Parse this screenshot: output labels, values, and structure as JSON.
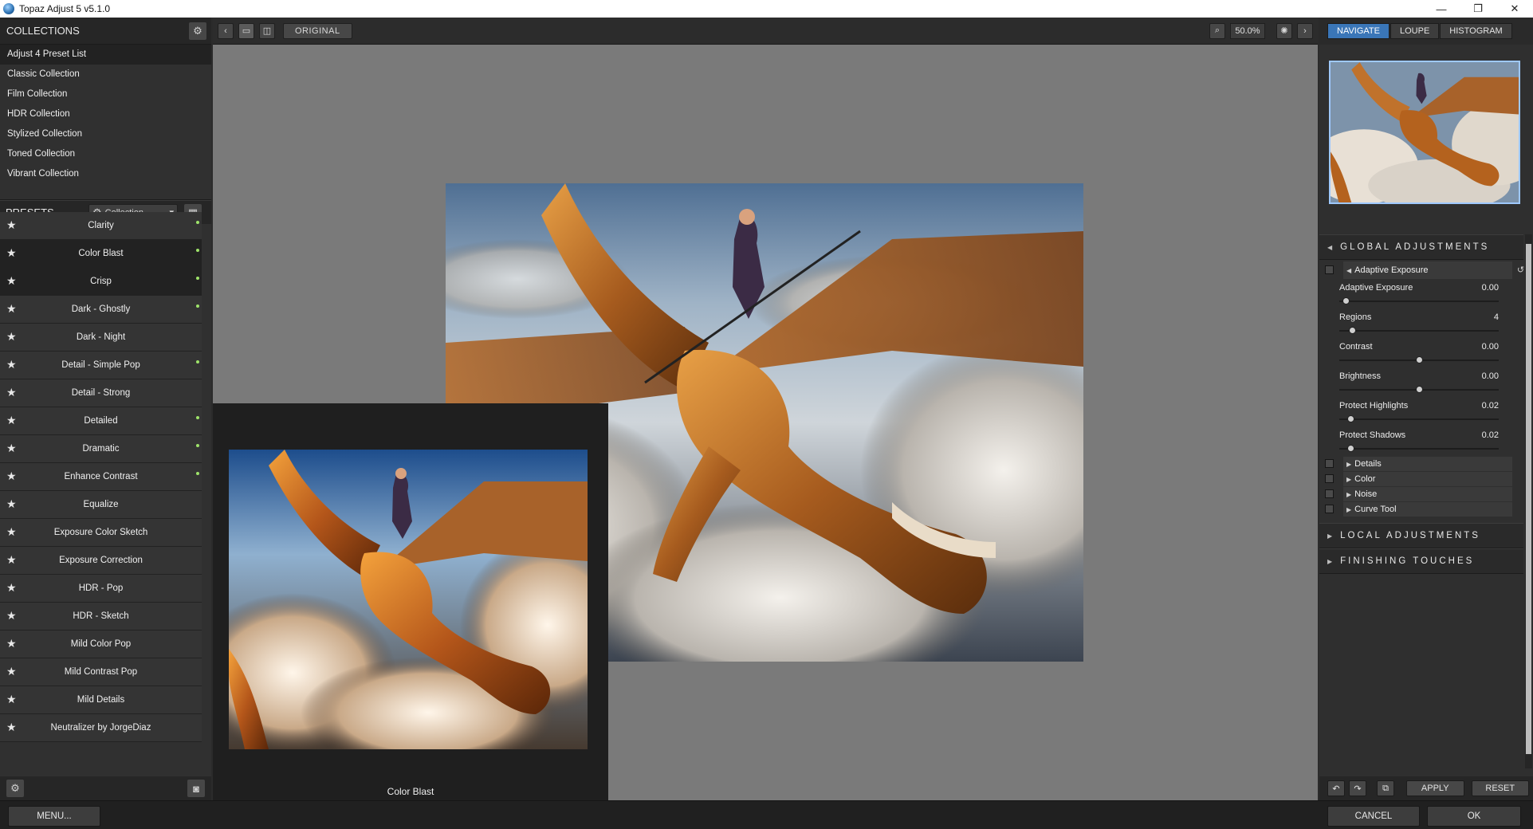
{
  "window": {
    "title": "Topaz Adjust 5 v5.1.0",
    "controls": [
      "—",
      "❐",
      "✕"
    ]
  },
  "collections": {
    "title": "COLLECTIONS",
    "items": [
      "Adjust 4 Preset List",
      "Classic Collection",
      "Film Collection",
      "HDR Collection",
      "Stylized Collection",
      "Toned Collection",
      "Vibrant Collection"
    ]
  },
  "presets": {
    "title": "PRESETS",
    "dropdown": "Collection...",
    "items": [
      "Clarity",
      "Color Blast",
      "Crisp",
      "Dark - Ghostly",
      "Dark - Night",
      "Detail - Simple Pop",
      "Detail - Strong",
      "Detailed",
      "Dramatic",
      "Enhance Contrast",
      "Equalize",
      "Exposure Color Sketch",
      "Exposure Correction",
      "HDR - Pop",
      "HDR - Sketch",
      "Mild Color Pop",
      "Mild Contrast Pop",
      "Mild Details",
      "Neutralizer by JorgeDiaz"
    ]
  },
  "toolbar": {
    "original": "ORIGINAL",
    "zoom": "50.0%"
  },
  "preview": {
    "caption": "Color Blast"
  },
  "right_panel": {
    "tabs": [
      "NAVIGATE",
      "LOUPE",
      "HISTOGRAM"
    ],
    "global_title": "GLOBAL ADJUSTMENTS",
    "adaptive_title": "Adaptive Exposure",
    "sliders": [
      {
        "label": "Adaptive Exposure",
        "value": "0.00",
        "pos": 0.04
      },
      {
        "label": "Regions",
        "value": "4",
        "pos": 0.08
      },
      {
        "label": "Contrast",
        "value": "0.00",
        "pos": 0.5
      },
      {
        "label": "Brightness",
        "value": "0.00",
        "pos": 0.5
      },
      {
        "label": "Protect Highlights",
        "value": "0.02",
        "pos": 0.07
      },
      {
        "label": "Protect Shadows",
        "value": "0.02",
        "pos": 0.07
      }
    ],
    "subsections": [
      "Details",
      "Color",
      "Noise",
      "Curve Tool"
    ],
    "local_title": "LOCAL ADJUSTMENTS",
    "finishing_title": "FINISHING TOUCHES",
    "apply": "APPLY",
    "reset": "RESET"
  },
  "bottom": {
    "menu": "MENU...",
    "cancel": "CANCEL",
    "ok": "OK"
  }
}
